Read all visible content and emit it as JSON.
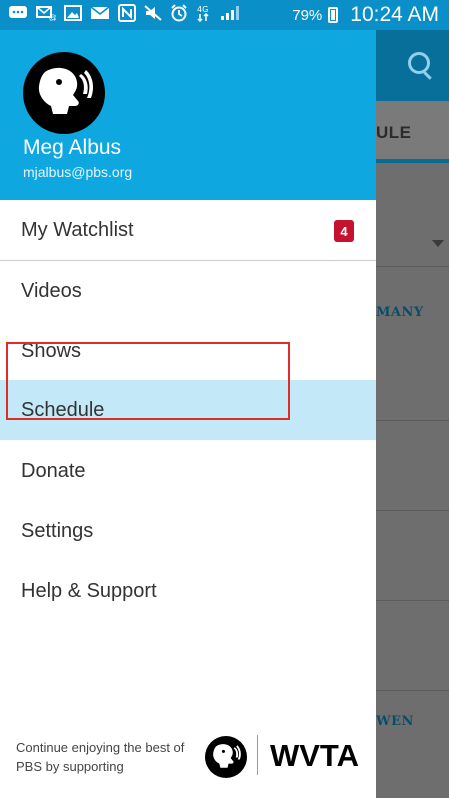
{
  "status_bar": {
    "battery": "79%",
    "time": "10:24 AM"
  },
  "profile": {
    "name": "Meg Albus",
    "email": "mjalbus@pbs.org"
  },
  "menu": [
    {
      "label": "My Watchlist",
      "badge": "4"
    },
    {
      "label": "Videos"
    },
    {
      "label": "Shows"
    },
    {
      "label": "Schedule",
      "selected": true
    },
    {
      "label": "Donate"
    },
    {
      "label": "Settings"
    },
    {
      "label": "Help & Support"
    }
  ],
  "footer": {
    "text": "Continue enjoying the best of PBS by supporting",
    "station": "WVTA"
  },
  "background": {
    "tab_partial": "ULE",
    "text_1": "MANY",
    "text_2": "WEN"
  },
  "colors": {
    "header_blue": "#0ea7e0",
    "selected": "#c3e8f8",
    "badge": "#c4122f"
  }
}
